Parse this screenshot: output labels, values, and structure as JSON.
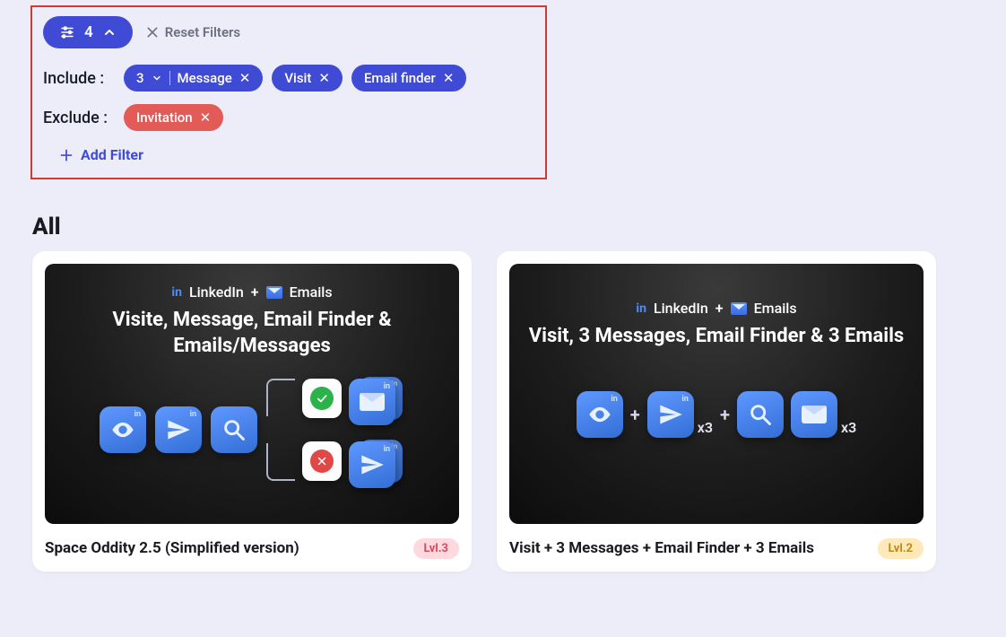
{
  "filters": {
    "count": "4",
    "reset_label": "Reset Filters",
    "include_label": "Include :",
    "exclude_label": "Exclude :",
    "add_filter_label": "Add Filter",
    "include": [
      {
        "prefix": "3",
        "label": "Message"
      },
      {
        "label": "Visit"
      },
      {
        "label": "Email finder"
      }
    ],
    "exclude": [
      {
        "label": "Invitation"
      }
    ]
  },
  "section_title": "All",
  "cards": [
    {
      "channel1": "LinkedIn",
      "channel2": "Emails",
      "thumb_title": "Visite, Message, Email Finder & Emails/Messages",
      "title": "Space Oddity 2.5 (Simplified version)",
      "level": "Lvl.3"
    },
    {
      "channel1": "LinkedIn",
      "channel2": "Emails",
      "thumb_title": "Visit, 3 Messages, Email Finder & 3 Emails",
      "mult1": "x3",
      "mult2": "x3",
      "title": "Visit + 3 Messages + Email Finder + 3 Emails",
      "level": "Lvl.2"
    }
  ]
}
